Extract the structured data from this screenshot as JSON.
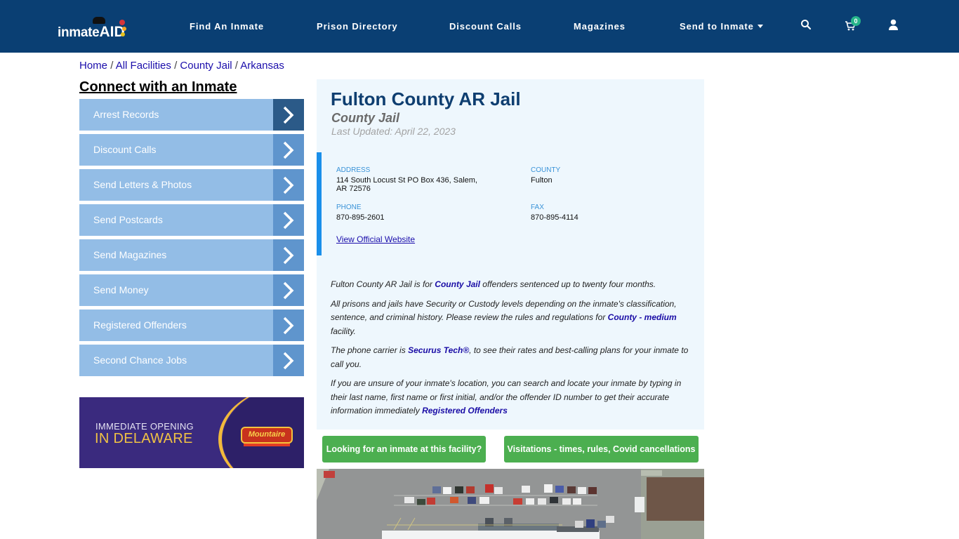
{
  "header": {
    "logo_text": "inmate",
    "logo_suffix": "AID",
    "nav": [
      {
        "label": "Find An Inmate"
      },
      {
        "label": "Prison Directory"
      },
      {
        "label": "Discount Calls"
      },
      {
        "label": "Magazines"
      },
      {
        "label": "Send to Inmate"
      }
    ],
    "icons": [
      "search-icon",
      "cart-icon",
      "user-icon"
    ],
    "cart_count": "0"
  },
  "breadcrumb": [
    {
      "label": "Home"
    },
    {
      "label": "All Facilities"
    },
    {
      "label": "County Jail"
    },
    {
      "label": "Arkansas"
    }
  ],
  "breadcrumb_sep": "/",
  "sidebar": {
    "title": "Connect with an Inmate",
    "items": [
      {
        "label": "Arrest Records"
      },
      {
        "label": "Discount Calls"
      },
      {
        "label": "Send Letters & Photos"
      },
      {
        "label": "Send Postcards"
      },
      {
        "label": "Send Magazines"
      },
      {
        "label": "Send Money"
      },
      {
        "label": "Registered Offenders"
      },
      {
        "label": "Second Chance Jobs"
      }
    ]
  },
  "ad": {
    "line1": "IMMEDIATE OPENING",
    "line2": "IN DELAWARE",
    "brand": "Mountaire"
  },
  "facility": {
    "name": "Fulton County AR Jail",
    "type": "County Jail",
    "last_updated": "Last Updated: April 22, 2023",
    "address_label": "ADDRESS",
    "address_line1": "114 South Locust St PO Box 436, Salem,",
    "address_line2": "AR 72576",
    "county_label": "COUNTY",
    "county": "Fulton",
    "phone_label": "PHONE",
    "phone": "870-895-2601",
    "fax_label": "FAX",
    "fax": "870-895-4114",
    "website_link": "View Official Website"
  },
  "description": {
    "p1_a": "Fulton County AR Jail is for ",
    "p1_link": "County Jail",
    "p1_b": " offenders sentenced up to twenty four months.",
    "p2_a": "All prisons and jails have Security or Custody levels depending on the inmate's classification, sentence, and criminal history. Please review the rules and regulations for ",
    "p2_link": "County - medium",
    "p2_b": " facility.",
    "p3_a": "The phone carrier is ",
    "p3_link": "Securus Tech®",
    "p3_b": ", to see their rates and best-calling plans for your inmate to call you.",
    "p4_a": "If you are unsure of your inmate's location, you can search and locate your inmate by typing in their last name, first name or first initial, and/or the offender ID number to get their accurate information immediately ",
    "p4_link": "Registered Offenders"
  },
  "buttons": {
    "find_inmate": "Looking for an inmate at this facility?",
    "visitations": "Visitations - times, rules, Covid cancellations"
  }
}
